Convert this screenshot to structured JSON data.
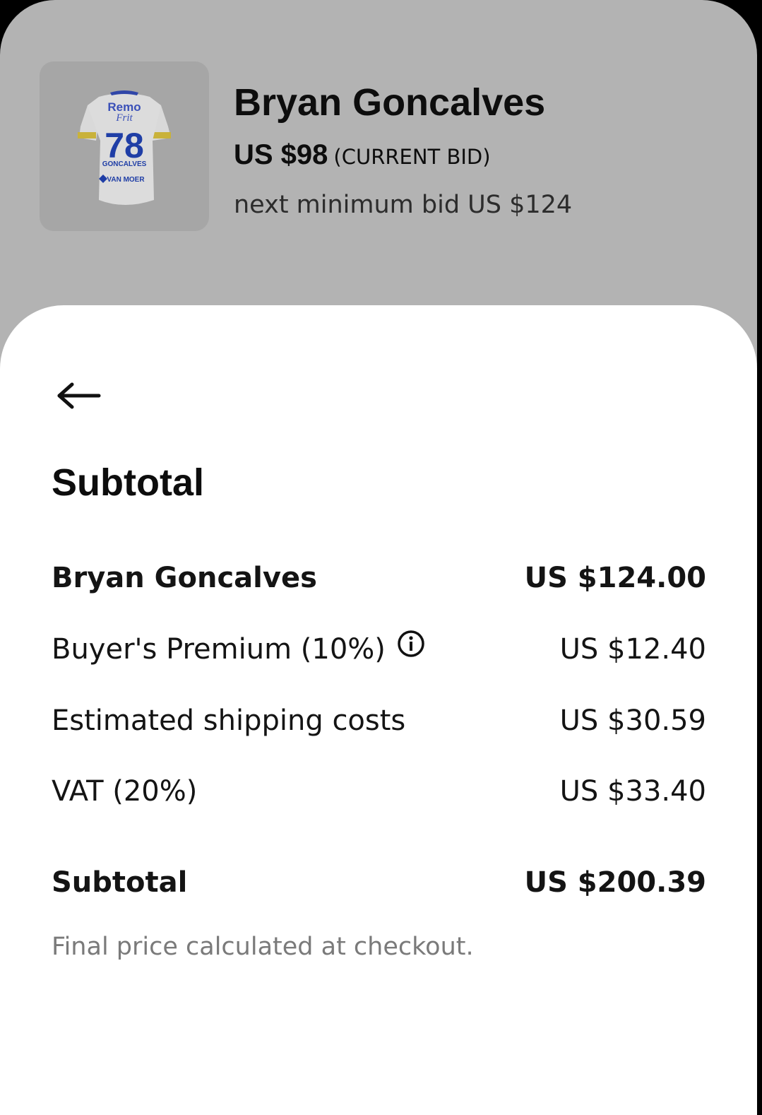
{
  "header": {
    "title": "Bryan Goncalves",
    "current_bid_amount": "US $98",
    "current_bid_label": "(CURRENT BID)",
    "next_min_bid": "next minimum bid US $124",
    "jersey": {
      "sponsor_top": "Remo",
      "sponsor_sub": "Frit",
      "number": "78",
      "name": "GONCALVES",
      "sponsor_bottom": "VAN MOER"
    }
  },
  "sheet": {
    "title": "Subtotal",
    "rows": [
      {
        "label": "Bryan Goncalves",
        "value": "US $124.00"
      },
      {
        "label": "Buyer's Premium (10%)",
        "value": "US $12.40"
      },
      {
        "label": "Estimated shipping costs",
        "value": "US $30.59"
      },
      {
        "label": "VAT (20%)",
        "value": "US $33.40"
      }
    ],
    "total": {
      "label": "Subtotal",
      "value": "US $200.39"
    },
    "note": "Final price calculated at checkout."
  },
  "icons": {
    "back": "arrow-left-icon",
    "info": "info-icon"
  }
}
